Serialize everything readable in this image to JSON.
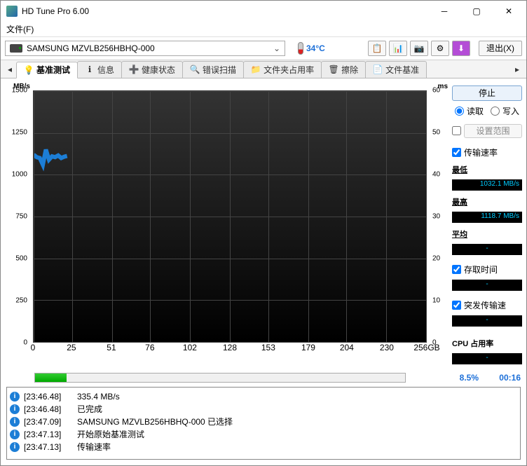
{
  "window": {
    "title": "HD Tune Pro 6.00"
  },
  "menu": {
    "file": "文件(F)"
  },
  "toolbar": {
    "drive": "SAMSUNG MZVLB256HBHQ-000",
    "temperature": "34°C",
    "exit": "退出(X)"
  },
  "tabs": {
    "benchmark": "基准测试",
    "info": "信息",
    "health": "健康状态",
    "errorscan": "错误扫描",
    "folderusage": "文件夹占用率",
    "erase": "擦除",
    "filebench": "文件基准"
  },
  "chart_data": {
    "type": "line",
    "title": "",
    "xlabel": "",
    "ylabel_left": "MB/s",
    "ylabel_right": "ms",
    "xlim": [
      0,
      256
    ],
    "xunit": "GB",
    "ylim_left": [
      0,
      1500
    ],
    "ylim_right": [
      0,
      60
    ],
    "xticks": [
      0,
      25,
      51,
      76,
      102,
      128,
      153,
      179,
      204,
      230,
      256
    ],
    "yticks_left": [
      0,
      250,
      500,
      750,
      1000,
      1250,
      1500
    ],
    "yticks_right": [
      0,
      10,
      20,
      30,
      40,
      50,
      60
    ],
    "series": [
      {
        "name": "transfer_rate",
        "unit": "MB/s",
        "x": [
          0,
          2,
          4,
          6,
          8,
          10,
          12,
          14,
          16,
          18,
          20,
          21.8
        ],
        "y": [
          1120,
          1105,
          1100,
          1060,
          1150,
          1090,
          1110,
          1105,
          1115,
          1100,
          1108,
          1112
        ]
      }
    ]
  },
  "units": {
    "mbs": "MB/s",
    "ms": "ms",
    "xmax_label": "256GB"
  },
  "sidebar": {
    "stop": "停止",
    "read": "读取",
    "write": "写入",
    "set_range": "设置范围",
    "transfer_rate": "传输速率",
    "min": "最低",
    "min_val": "1032.1 MB/s",
    "max": "最高",
    "max_val": "1118.7 MB/s",
    "avg": "平均",
    "avg_val": "-",
    "access_time": "存取时间",
    "access_val": "-",
    "burst": "突发传输速",
    "burst_val": "-",
    "cpu": "CPU 占用率",
    "cpu_val": "-"
  },
  "progress": {
    "percent": "8.5%",
    "elapsed": "00:16",
    "fill_pct": 8.5
  },
  "log": [
    {
      "time": "[23:46.48]",
      "msg": "335.4 MB/s"
    },
    {
      "time": "[23:46.48]",
      "msg": "已完成"
    },
    {
      "time": "[23:47.09]",
      "msg": "SAMSUNG MZVLB256HBHQ-000 已选择"
    },
    {
      "time": "[23:47.13]",
      "msg": "开始原始基准测试"
    },
    {
      "time": "[23:47.13]",
      "msg": "传输速率"
    }
  ]
}
